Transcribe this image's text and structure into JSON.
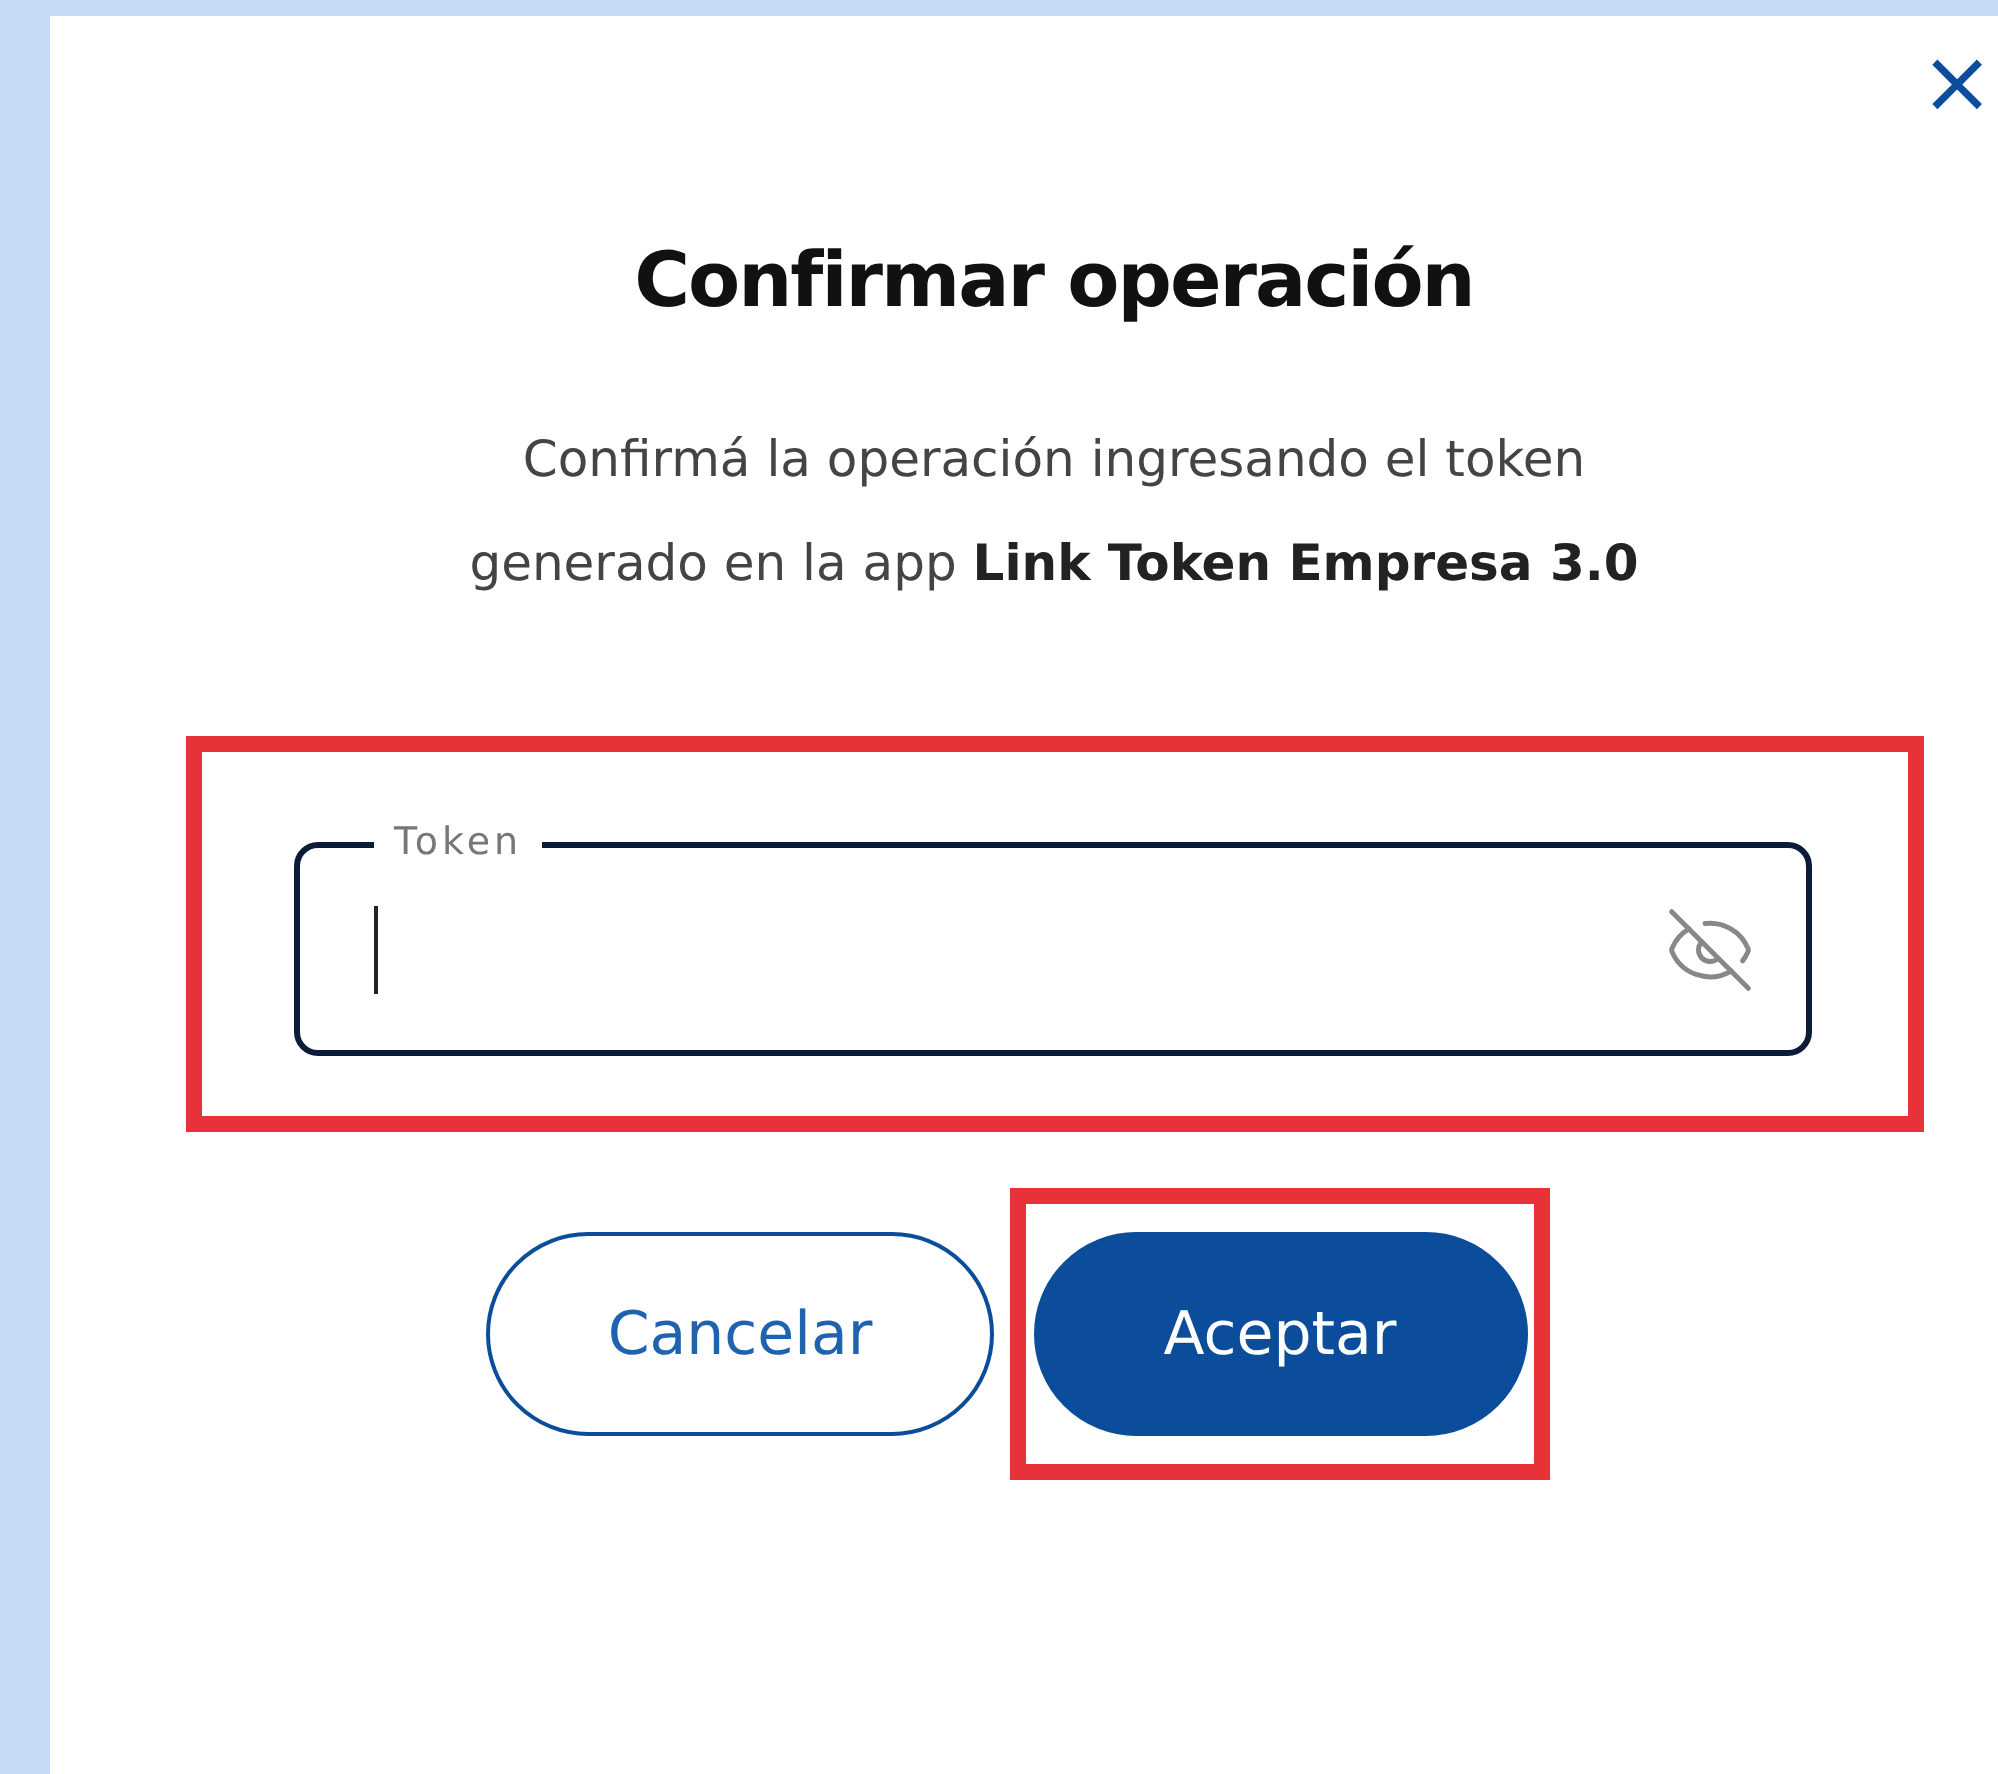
{
  "dialog": {
    "title": "Confirmar operación",
    "close": "×",
    "message": "Confirmá la operación ingresando el token generado en la app **Link Token Empresa 3.0**",
    "field": {
      "label": "Token",
      "focused": true,
      "masked": true,
      "highlighted": true
    },
    "buttons": [
      {
        "label": "Cancelar",
        "kind": "secondary",
        "highlighted": false
      },
      {
        "label": "Aceptar",
        "kind": "primary",
        "highlighted": true
      }
    ]
  }
}
